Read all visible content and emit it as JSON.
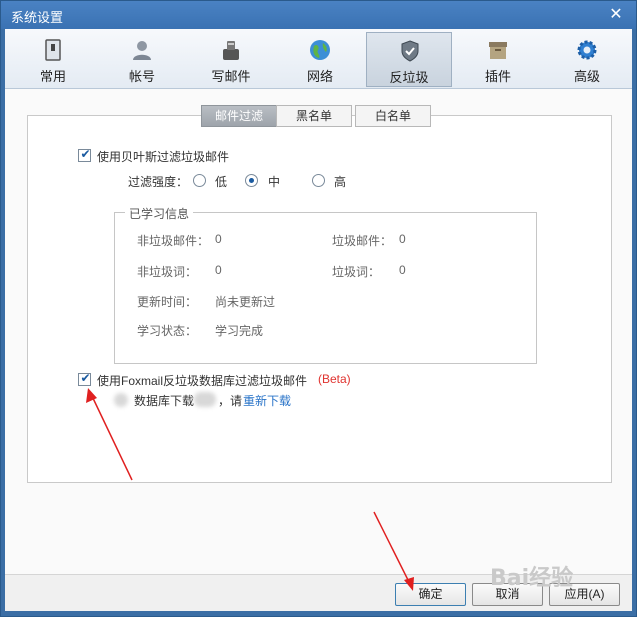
{
  "window": {
    "title": "系统设置"
  },
  "toolbar": {
    "items": [
      {
        "label": "常用",
        "icon": "general-settings-icon"
      },
      {
        "label": "帐号",
        "icon": "account-icon"
      },
      {
        "label": "写邮件",
        "icon": "compose-icon"
      },
      {
        "label": "网络",
        "icon": "network-globe-icon"
      },
      {
        "label": "反垃圾",
        "icon": "shield-icon",
        "active": true
      },
      {
        "label": "插件",
        "icon": "plugin-box-icon"
      },
      {
        "label": "高级",
        "icon": "gear-icon"
      }
    ]
  },
  "tabs": [
    {
      "label": "邮件过滤",
      "active": true
    },
    {
      "label": "黑名单"
    },
    {
      "label": "白名单"
    }
  ],
  "bayes": {
    "checkbox_label": "使用贝叶斯过滤垃圾邮件",
    "checked": true,
    "strength_label": "过滤强度：",
    "options": [
      "低",
      "中",
      "高"
    ],
    "selected": "中"
  },
  "learned": {
    "title": "已学习信息",
    "nonspam_mail_label": "非垃圾邮件：",
    "nonspam_mail_value": "0",
    "spam_mail_label": "垃圾邮件：",
    "spam_mail_value": "0",
    "nonspam_word_label": "非垃圾词：",
    "nonspam_word_value": "0",
    "spam_word_label": "垃圾词：",
    "spam_word_value": "0",
    "update_time_label": "更新时间：",
    "update_time_value": "尚未更新过",
    "status_label": "学习状态：",
    "status_value": "学习完成"
  },
  "foxmail_db": {
    "checkbox_label": "使用Foxmail反垃圾数据库过滤垃圾邮件",
    "beta": "(Beta)",
    "checked": true,
    "download_text": "数据库下载",
    "comma_text": "，请",
    "redownload_link": "重新下载"
  },
  "buttons": {
    "ok": "确定",
    "cancel": "取消",
    "apply": "应用(A)"
  },
  "watermark": "Bai经验",
  "colors": {
    "accent": "#2a74c8",
    "beta": "#e0332f",
    "titlebar": "#3a72b3",
    "annotation_arrow": "#e02020"
  }
}
